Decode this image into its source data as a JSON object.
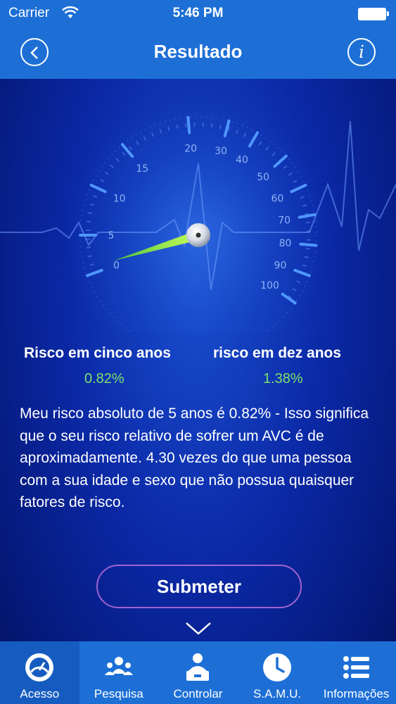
{
  "status": {
    "carrier": "Carrier",
    "time": "5:46 PM"
  },
  "nav": {
    "title": "Resultado",
    "info_glyph": "i"
  },
  "gauge": {
    "ticks": [
      "0",
      "5",
      "10",
      "15",
      "20",
      "30",
      "40",
      "50",
      "60",
      "70",
      "80",
      "90",
      "100"
    ],
    "needle_value": 0.82
  },
  "risk": {
    "five_label": "Risco em cinco anos",
    "five_value": "0.82%",
    "ten_label": "risco em dez anos",
    "ten_value": "1.38%"
  },
  "description": "Meu risco absoluto de 5 anos é 0.82% - Isso significa que o seu risco relativo de sofrer um AVC é de aproximadamente. 4.30 vezes do que uma pessoa com a sua idade e sexo que não possua quaisquer fatores de risco.",
  "submit_label": "Submeter",
  "tabs": [
    {
      "label": "Acesso",
      "icon": "gauge-icon"
    },
    {
      "label": "Pesquisa",
      "icon": "people-icon"
    },
    {
      "label": "Controlar",
      "icon": "operator-icon"
    },
    {
      "label": "S.A.M.U.",
      "icon": "clock-icon"
    },
    {
      "label": "Informações",
      "icon": "list-icon"
    }
  ],
  "colors": {
    "bar": "#1d6fd6",
    "accent_green": "#7ee06b",
    "background": "#0b2aa8"
  }
}
